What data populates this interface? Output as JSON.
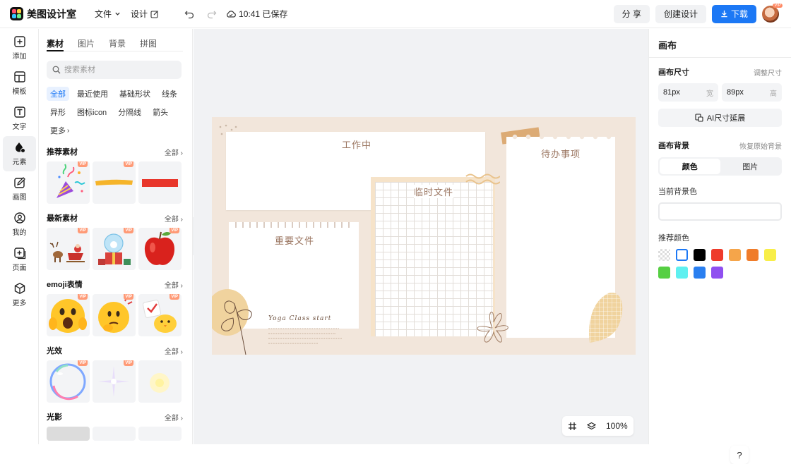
{
  "header": {
    "app_name": "美图设计室",
    "menu_file": "文件",
    "menu_design": "设计",
    "save_status": "10:41 已保存",
    "share_label": "分 享",
    "create_label": "创建设计",
    "download_label": "下载",
    "avatar_badge": "VIP"
  },
  "rail": {
    "items": [
      {
        "label": "添加",
        "icon": "plus-square-icon"
      },
      {
        "label": "模板",
        "icon": "template-icon"
      },
      {
        "label": "文字",
        "icon": "text-icon"
      },
      {
        "label": "元素",
        "icon": "shapes-icon"
      },
      {
        "label": "画图",
        "icon": "draw-icon"
      },
      {
        "label": "我的",
        "icon": "user-icon"
      },
      {
        "label": "页面",
        "icon": "page-add-icon"
      },
      {
        "label": "更多",
        "icon": "cube-icon"
      }
    ]
  },
  "panel": {
    "tabs": [
      "素材",
      "图片",
      "背景",
      "拼图"
    ],
    "search_placeholder": "搜索素材",
    "chips": [
      "全部",
      "最近使用",
      "基础形状",
      "线条",
      "异形",
      "图标icon",
      "分隔线",
      "箭头",
      "更多"
    ],
    "all_label": "全部",
    "sections": [
      {
        "title": "推荐素材"
      },
      {
        "title": "最新素材"
      },
      {
        "title": "emoji表情"
      },
      {
        "title": "光效"
      },
      {
        "title": "光影"
      }
    ],
    "vip_label": "VIP"
  },
  "canvas": {
    "note_working": "工作中",
    "note_todo": "待办事项",
    "note_temp": "临时文件",
    "note_important": "重要文件",
    "yoga_text": "Yoga Class start",
    "zoom": "100%",
    "help": "?"
  },
  "right_panel": {
    "title": "画布",
    "size_label": "画布尺寸",
    "resize_link": "调整尺寸",
    "width_value": "81px",
    "width_unit": "宽",
    "height_value": "89px",
    "height_unit": "高",
    "ai_extend_label": "AI尺寸延展",
    "bg_label": "画布背景",
    "restore_link": "恢复原始背景",
    "seg_color": "颜色",
    "seg_image": "图片",
    "current_bg_label": "当前背景色",
    "recommend_label": "推荐颜色",
    "colors": [
      "transparent",
      "#ffffff",
      "#000000",
      "#ee3b2b",
      "#f5a54a",
      "#f07c2a",
      "#f8ee48",
      "#56cf43",
      "#5ef0f0",
      "#2a7ff0",
      "#8f4ff0"
    ]
  }
}
